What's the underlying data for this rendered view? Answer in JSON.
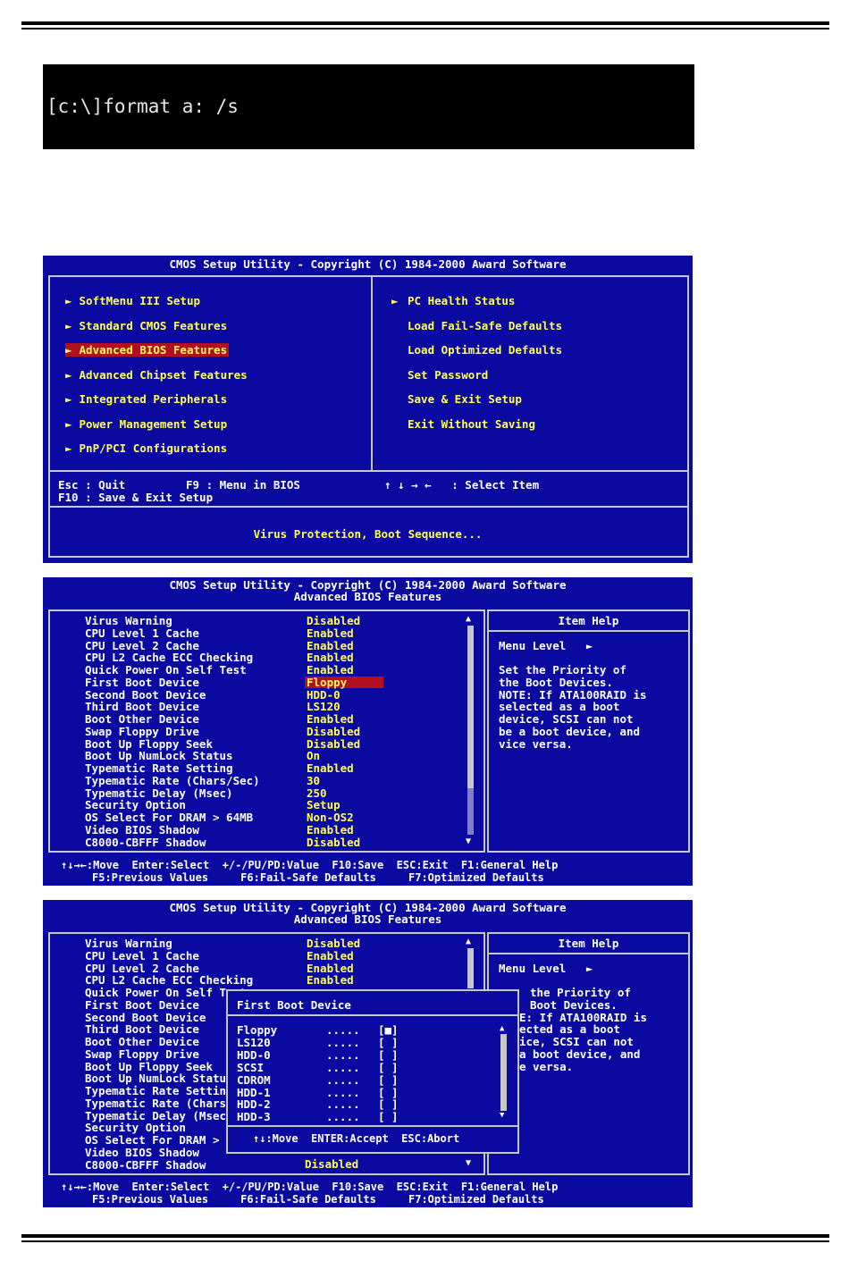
{
  "command": {
    "text": "[c:\\]format a: /s"
  },
  "header_title": "CMOS Setup Utility - Copyright (C) 1984-2000 Award Software",
  "main_menu": {
    "left_items": [
      {
        "label": "SoftMenu III Setup",
        "arrow": "►",
        "selected": false
      },
      {
        "label": "Standard CMOS Features",
        "arrow": "►",
        "selected": false
      },
      {
        "label": "Advanced BIOS Features",
        "arrow": "►",
        "selected": true
      },
      {
        "label": "Advanced Chipset Features",
        "arrow": "►",
        "selected": false
      },
      {
        "label": "Integrated Peripherals",
        "arrow": "►",
        "selected": false
      },
      {
        "label": "Power Management Setup",
        "arrow": "►",
        "selected": false
      },
      {
        "label": "PnP/PCI Configurations",
        "arrow": "►",
        "selected": false
      }
    ],
    "right_items": [
      {
        "label": "PC Health Status",
        "arrow": "►"
      },
      {
        "label": "Load Fail-Safe Defaults",
        "arrow": ""
      },
      {
        "label": "Load Optimized Defaults",
        "arrow": ""
      },
      {
        "label": "Set Password",
        "arrow": ""
      },
      {
        "label": "Save & Exit Setup",
        "arrow": ""
      },
      {
        "label": "Exit Without Saving",
        "arrow": ""
      }
    ],
    "key_line1_a": "Esc : Quit",
    "key_line1_b": "F9 : Menu in BIOS",
    "key_line1_c": "↑ ↓ → ←   : Select Item",
    "key_line2": "F10 : Save & Exit Setup",
    "status": "Virus Protection, Boot Sequence..."
  },
  "advanced": {
    "subtitle": "Advanced BIOS Features",
    "rows": [
      {
        "label": "Virus Warning",
        "value": "Disabled"
      },
      {
        "label": "CPU Level 1 Cache",
        "value": "Enabled"
      },
      {
        "label": "CPU Level 2 Cache",
        "value": "Enabled"
      },
      {
        "label": "CPU L2 Cache ECC Checking",
        "value": "Enabled"
      },
      {
        "label": "Quick Power On Self Test",
        "value": "Enabled"
      },
      {
        "label": "First Boot Device",
        "value": "Floppy",
        "selected": true
      },
      {
        "label": "Second Boot Device",
        "value": "HDD-0"
      },
      {
        "label": "Third Boot Device",
        "value": "LS120"
      },
      {
        "label": "Boot Other Device",
        "value": "Enabled"
      },
      {
        "label": "Swap Floppy Drive",
        "value": "Disabled"
      },
      {
        "label": "Boot Up Floppy Seek",
        "value": "Disabled"
      },
      {
        "label": "Boot Up NumLock Status",
        "value": "On"
      },
      {
        "label": "Typematic Rate Setting",
        "value": "Enabled"
      },
      {
        "label": "Typematic Rate (Chars/Sec)",
        "value": "30"
      },
      {
        "label": "Typematic Delay (Msec)",
        "value": "250"
      },
      {
        "label": "Security Option",
        "value": "Setup"
      },
      {
        "label": "OS Select For DRAM > 64MB",
        "value": "Non-OS2"
      },
      {
        "label": "Video BIOS Shadow",
        "value": "Enabled"
      },
      {
        "label": "C8000-CBFFF Shadow",
        "value": "Disabled"
      }
    ],
    "help_title": "Item Help",
    "menu_level": "Menu Level   ►",
    "help_lines": [
      "Set the Priority of",
      "the Boot Devices.",
      "NOTE: If ATA100RAID is",
      "selected as a boot",
      "device, SCSI can not",
      "be a boot device, and",
      "vice versa."
    ]
  },
  "footer": {
    "line1": "↑↓→←:Move  Enter:Select  +/-/PU/PD:Value  F10:Save  ESC:Exit  F1:General Help",
    "line2": "F5:Previous Values     F6:Fail-Safe Defaults     F7:Optimized Defaults"
  },
  "popup": {
    "title": "First Boot Device",
    "options": [
      {
        "name": "Floppy",
        "mark": "[■]"
      },
      {
        "name": "LS120",
        "mark": "[ ]"
      },
      {
        "name": "HDD-0",
        "mark": "[ ]"
      },
      {
        "name": "SCSI",
        "mark": "[ ]"
      },
      {
        "name": "CDROM",
        "mark": "[ ]"
      },
      {
        "name": "HDD-1",
        "mark": "[ ]"
      },
      {
        "name": "HDD-2",
        "mark": "[ ]"
      },
      {
        "name": "HDD-3",
        "mark": "[ ]"
      }
    ],
    "dots": ".....",
    "keys": "↑↓:Move  ENTER:Accept  ESC:Abort"
  },
  "screen3": {
    "help_lines": [
      "the Priority of",
      "Boot Devices.",
      "E: If ATA100RAID is",
      "ected as a boot",
      "ice, SCSI can not",
      "a boot device, and",
      "e versa."
    ],
    "last_value": "Disabled"
  },
  "colors": {
    "bios_blue": "#0a0aa0",
    "highlight_red": "#b01020",
    "value_yellow": "#ffff55",
    "frame_gray": "#c8c8c8"
  }
}
